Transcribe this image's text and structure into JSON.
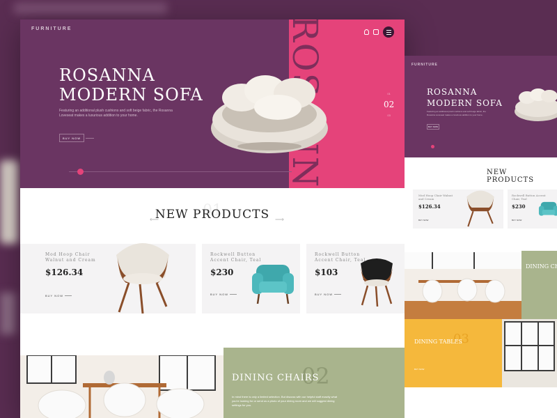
{
  "colors": {
    "plum": "#6a3562",
    "pink": "#e5437a",
    "sage": "#a9b48d",
    "mustard": "#f5b83c",
    "card_bg": "#f4f3f4"
  },
  "main": {
    "logo": "FURNITURE",
    "hero": {
      "title_line1": "ROSANNA",
      "title_line2": "MODERN SOFA",
      "vertical_text": "ROSANNA",
      "description": "Featuring an additional plush cushions and soft beige fabric, the Rosanna Loveseat makes a luxurious addition to your home.",
      "buy_label": "BUY NOW",
      "pager_prev": "01",
      "pager_current": "02",
      "pager_next": "03",
      "slide_progress": 0.05
    },
    "new_products": {
      "title": "NEW PRODUCTS",
      "number": "01",
      "prev_arrow": "⟵",
      "next_arrow": "⟶",
      "items": [
        {
          "name": "Mod Hoop Chair Walnut and Cream",
          "price": "$126.34",
          "buy": "BUY NOW"
        },
        {
          "name": "Rockwell Button Accent Chair, Teal",
          "price": "$230",
          "buy": "BUY NOW"
        },
        {
          "name": "Rockwell Button Accent Chair, Teal",
          "price": "$103",
          "buy": "BUY NOW"
        }
      ]
    },
    "dining": {
      "title": "DINING CHAIRS",
      "number": "02",
      "description": "In mind there is only a limited selection. But discuss with our helpful staff exactly what you're looking for or send us a photo of your dining room and we will suggest dining settings for you."
    }
  },
  "second": {
    "logo": "FURNITURE",
    "hero": {
      "title_line1": "ROSANNA",
      "title_line2": "MODERN SOFA",
      "description": "Featuring an additional plush cushions and soft beige fabric, the Rosanna Loveseat makes a luxurious addition to your home.",
      "buy_label": "BUY NOW"
    },
    "new_products": {
      "title": "NEW PRODUCTS",
      "items": [
        {
          "name": "Mod Hoop Chair Walnut and Cream",
          "price": "$126.34",
          "buy": "BUY NOW"
        },
        {
          "name": "Rockwell Button Accent Chair, Teal",
          "price": "$230",
          "buy": "BUY NOW"
        }
      ]
    },
    "dining": {
      "title": "DINING CH"
    },
    "tables": {
      "title": "DINING TABLES",
      "number": "03",
      "link": "BUY NOW"
    }
  }
}
